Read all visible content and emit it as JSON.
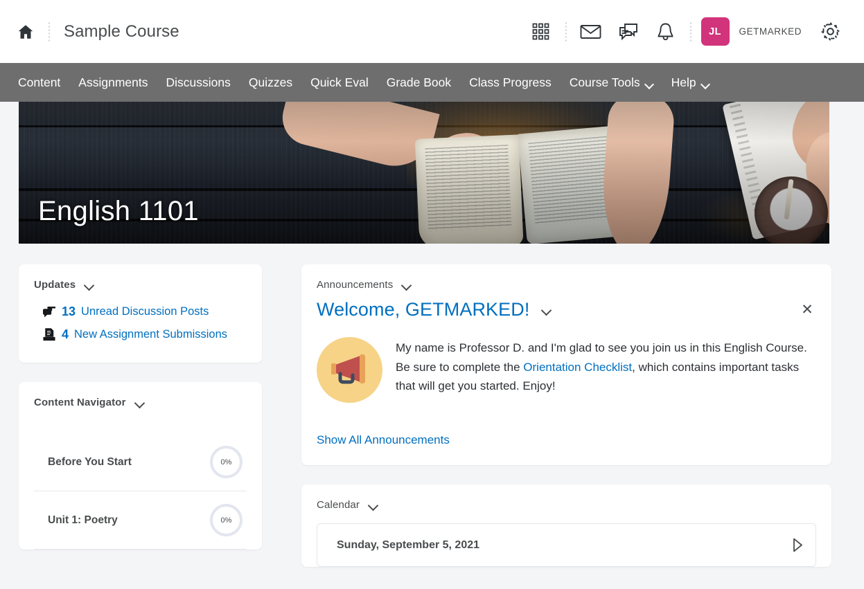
{
  "header": {
    "home_icon": "home-icon",
    "course_title": "Sample Course",
    "icons": [
      {
        "name": "waffle-grid-icon",
        "label": "Course Selector"
      },
      {
        "name": "envelope-icon",
        "label": "Email"
      },
      {
        "name": "chat-bubble-icon",
        "label": "Subscriptions"
      },
      {
        "name": "bell-icon",
        "label": "Notifications"
      }
    ],
    "avatar_initials": "JL",
    "avatar_color": "#d2347b",
    "username": "GETMARKED",
    "settings_icon": "gear-icon"
  },
  "navbar": {
    "items": [
      {
        "label": "Content",
        "has_chevron": false
      },
      {
        "label": "Assignments",
        "has_chevron": false
      },
      {
        "label": "Discussions",
        "has_chevron": false
      },
      {
        "label": "Quizzes",
        "has_chevron": false
      },
      {
        "label": "Quick Eval",
        "has_chevron": false
      },
      {
        "label": "Grade Book",
        "has_chevron": false
      },
      {
        "label": "Class Progress",
        "has_chevron": false
      },
      {
        "label": "Course Tools",
        "has_chevron": true
      },
      {
        "label": "Help",
        "has_chevron": true
      }
    ],
    "background": "#6e6e6e"
  },
  "hero": {
    "title": "English 1101",
    "image_description": "two students reading a book and writing in a notebook on a dark wooden table with an iced coffee"
  },
  "updates": {
    "title": "Updates",
    "rows": [
      {
        "icon": "discussion-bubble-icon",
        "count": "13",
        "label": "Unread Discussion Posts"
      },
      {
        "icon": "assignment-submission-icon",
        "count": "4",
        "label": "New Assignment Submissions"
      }
    ]
  },
  "content_navigator": {
    "title": "Content Navigator",
    "rows": [
      {
        "label": "Before You Start",
        "progress": "0%"
      },
      {
        "label": "Unit 1: Poetry",
        "progress": "0%"
      }
    ]
  },
  "announcements": {
    "title": "Announcements",
    "item_title": "Welcome, GETMARKED!",
    "icon": "megaphone-icon",
    "body_before_link": "My name is Professor D. and I'm glad to see you join us in this English Course. Be sure to complete the ",
    "body_link": "Orientation Checklist",
    "body_after_link": ", which contains important tasks that will get you started. Enjoy!",
    "close_label": "✕",
    "show_all": "Show All Announcements"
  },
  "calendar": {
    "title": "Calendar",
    "date": "Sunday, September 5, 2021",
    "arrow_icon": "play-triangle-icon"
  },
  "colors": {
    "link_blue": "#006fbf",
    "text_dark": "#494c4e",
    "page_background": "#f4f5f7",
    "nav_gray": "#6e6e6e",
    "accent_pink": "#d2347b"
  }
}
